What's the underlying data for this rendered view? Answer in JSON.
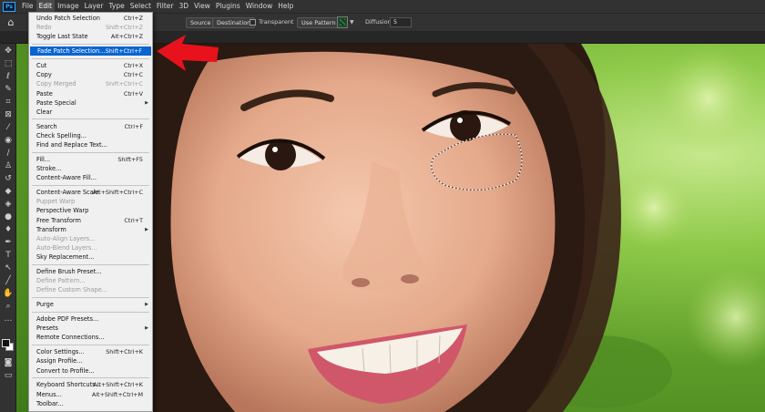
{
  "menubar": {
    "logo": "Ps",
    "items": [
      "File",
      "Edit",
      "Image",
      "Layer",
      "Type",
      "Select",
      "Filter",
      "3D",
      "View",
      "Plugins",
      "Window",
      "Help"
    ]
  },
  "options": {
    "home_icon": "home-icon",
    "source": "Source",
    "destination": "Destination",
    "transparent": "Transparent",
    "use_pattern": "Use Pattern",
    "diffusion_label": "Diffusion:",
    "diffusion_value": "5"
  },
  "edit_menu": {
    "undo": {
      "label": "Undo Patch Selection",
      "shortcut": "Ctrl+Z"
    },
    "redo": {
      "label": "Redo",
      "shortcut": "Shift+Ctrl+Z"
    },
    "toggle": {
      "label": "Toggle Last State",
      "shortcut": "Alt+Ctrl+Z"
    },
    "fade": {
      "label": "Fade Patch Selection...",
      "shortcut": "Shift+Ctrl+F"
    },
    "cut": {
      "label": "Cut",
      "shortcut": "Ctrl+X"
    },
    "copy": {
      "label": "Copy",
      "shortcut": "Ctrl+C"
    },
    "copy_merged": {
      "label": "Copy Merged",
      "shortcut": "Shift+Ctrl+C"
    },
    "paste": {
      "label": "Paste",
      "shortcut": "Ctrl+V"
    },
    "paste_special": {
      "label": "Paste Special"
    },
    "clear": {
      "label": "Clear"
    },
    "search": {
      "label": "Search",
      "shortcut": "Ctrl+F"
    },
    "check_spelling": {
      "label": "Check Spelling..."
    },
    "find_replace": {
      "label": "Find and Replace Text..."
    },
    "fill": {
      "label": "Fill...",
      "shortcut": "Shift+F5"
    },
    "stroke": {
      "label": "Stroke..."
    },
    "content_aware_fill": {
      "label": "Content-Aware Fill..."
    },
    "content_aware_scale": {
      "label": "Content-Aware Scale",
      "shortcut": "Alt+Shift+Ctrl+C"
    },
    "puppet_warp": {
      "label": "Puppet Warp"
    },
    "perspective_warp": {
      "label": "Perspective Warp"
    },
    "free_transform": {
      "label": "Free Transform",
      "shortcut": "Ctrl+T"
    },
    "transform": {
      "label": "Transform"
    },
    "auto_align": {
      "label": "Auto-Align Layers..."
    },
    "auto_blend": {
      "label": "Auto-Blend Layers..."
    },
    "sky_replacement": {
      "label": "Sky Replacement..."
    },
    "define_brush": {
      "label": "Define Brush Preset..."
    },
    "define_pattern": {
      "label": "Define Pattern..."
    },
    "define_shape": {
      "label": "Define Custom Shape..."
    },
    "purge": {
      "label": "Purge"
    },
    "pdf_presets": {
      "label": "Adobe PDF Presets..."
    },
    "presets": {
      "label": "Presets"
    },
    "remote": {
      "label": "Remote Connections..."
    },
    "color_settings": {
      "label": "Color Settings...",
      "shortcut": "Shift+Ctrl+K"
    },
    "assign_profile": {
      "label": "Assign Profile..."
    },
    "convert_profile": {
      "label": "Convert to Profile..."
    },
    "keyboard": {
      "label": "Keyboard Shortcuts...",
      "shortcut": "Alt+Shift+Ctrl+K"
    },
    "menus": {
      "label": "Menus...",
      "shortcut": "Alt+Shift+Ctrl+M"
    },
    "toolbar": {
      "label": "Toolbar..."
    }
  },
  "tools": [
    "move-tool-icon",
    "marquee-tool-icon",
    "lasso-tool-icon",
    "quick-select-tool-icon",
    "crop-tool-icon",
    "frame-tool-icon",
    "eyedropper-tool-icon",
    "patch-tool-icon",
    "brush-tool-icon",
    "clone-stamp-tool-icon",
    "history-brush-tool-icon",
    "eraser-tool-icon",
    "paint-bucket-tool-icon",
    "blur-tool-icon",
    "dodge-tool-icon",
    "pen-tool-icon",
    "type-tool-icon",
    "path-select-tool-icon",
    "line-tool-icon",
    "hand-tool-icon",
    "zoom-tool-icon",
    "more-tools-icon"
  ],
  "colors": {
    "menu_highlight": "#0a64d2",
    "arrow": "#e8121c",
    "foreground": "#111111",
    "background": "#ffffff"
  }
}
